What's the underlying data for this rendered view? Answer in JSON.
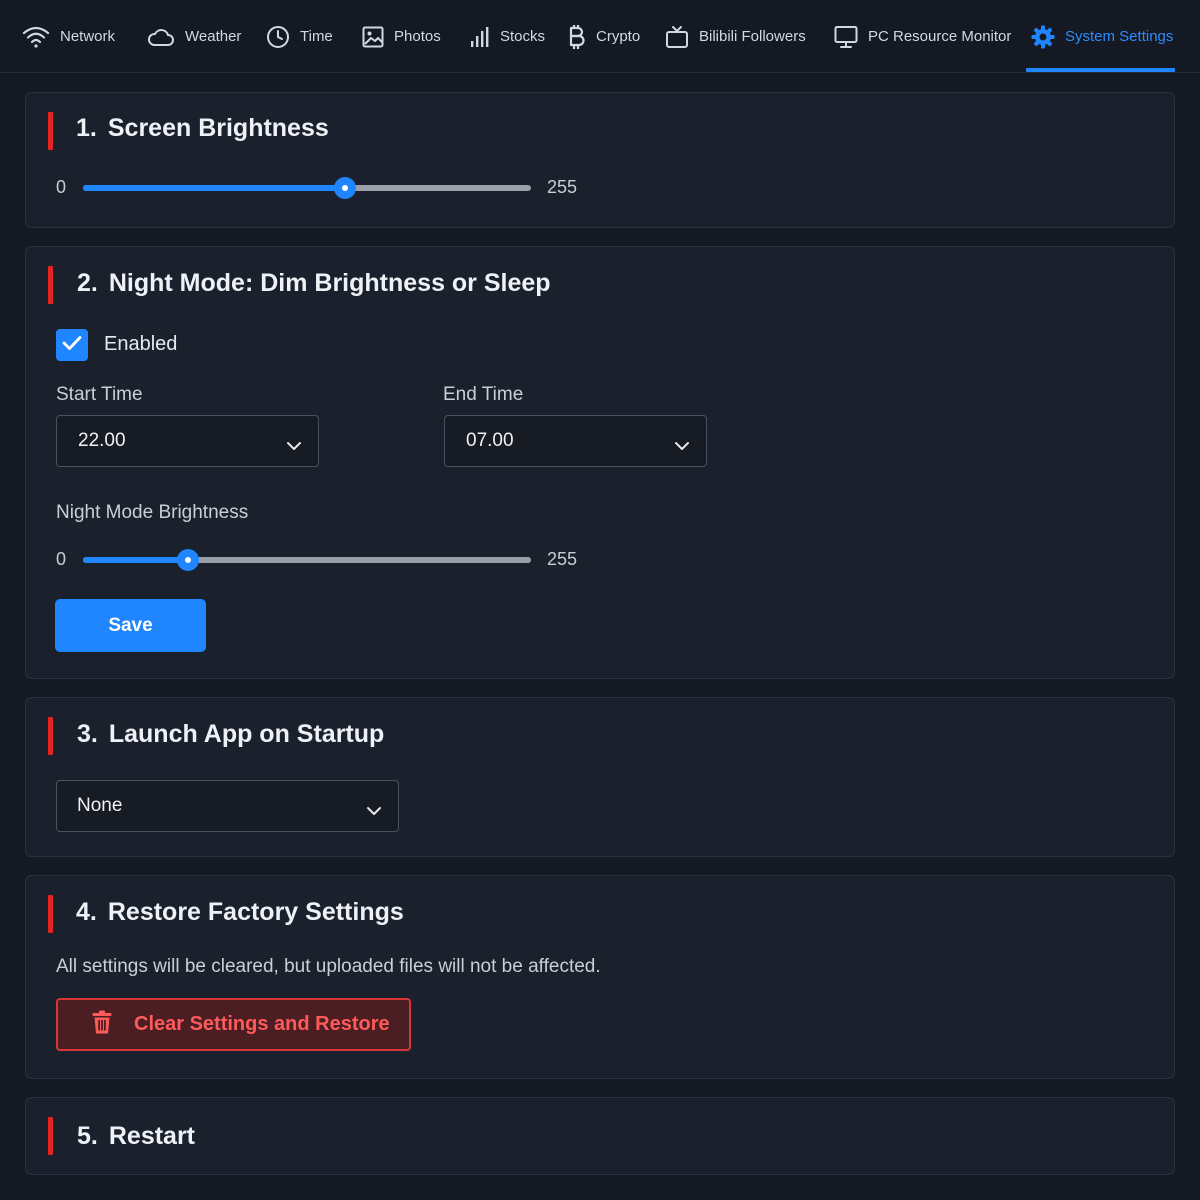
{
  "nav": {
    "tabs": [
      {
        "label": "Network",
        "icon": "wifi-icon"
      },
      {
        "label": "Weather",
        "icon": "cloud-icon"
      },
      {
        "label": "Time",
        "icon": "clock-icon"
      },
      {
        "label": "Photos",
        "icon": "image-icon"
      },
      {
        "label": "Stocks",
        "icon": "bar-chart-icon"
      },
      {
        "label": "Crypto",
        "icon": "bitcoin-icon"
      },
      {
        "label": "Bilibili Followers",
        "icon": "tv-icon"
      },
      {
        "label": "PC Resource Monitor",
        "icon": "monitor-icon"
      },
      {
        "label": "System Settings",
        "icon": "gear-icon",
        "active": true
      }
    ],
    "active_color": "#1f86ff"
  },
  "sections": {
    "brightness": {
      "number": "1.",
      "title": "Screen Brightness",
      "slider": {
        "min_label": "0",
        "max_label": "255",
        "min": 0,
        "max": 255,
        "value": 149
      }
    },
    "night_mode": {
      "number": "2.",
      "title": "Night Mode: Dim Brightness or Sleep",
      "enabled_label": "Enabled",
      "enabled": true,
      "start_time_label": "Start Time",
      "start_time_value": "22.00",
      "end_time_label": "End Time",
      "end_time_value": "07.00",
      "brightness_label": "Night Mode Brightness",
      "slider": {
        "min_label": "0",
        "max_label": "255",
        "min": 0,
        "max": 255,
        "value": 60
      },
      "save_label": "Save"
    },
    "launch": {
      "number": "3.",
      "title": "Launch App on Startup",
      "selected_value": "None"
    },
    "restore": {
      "number": "4.",
      "title": "Restore Factory Settings",
      "description": "All settings will be cleared, but uploaded files will not be affected.",
      "button_label": "Clear Settings and Restore"
    },
    "restart": {
      "number": "5.",
      "title": "Restart"
    }
  },
  "colors": {
    "accent": "#1f86ff",
    "section_marker": "#e32424",
    "danger": "#ff5a5a",
    "background": "#141923",
    "card": "#1b212c"
  }
}
